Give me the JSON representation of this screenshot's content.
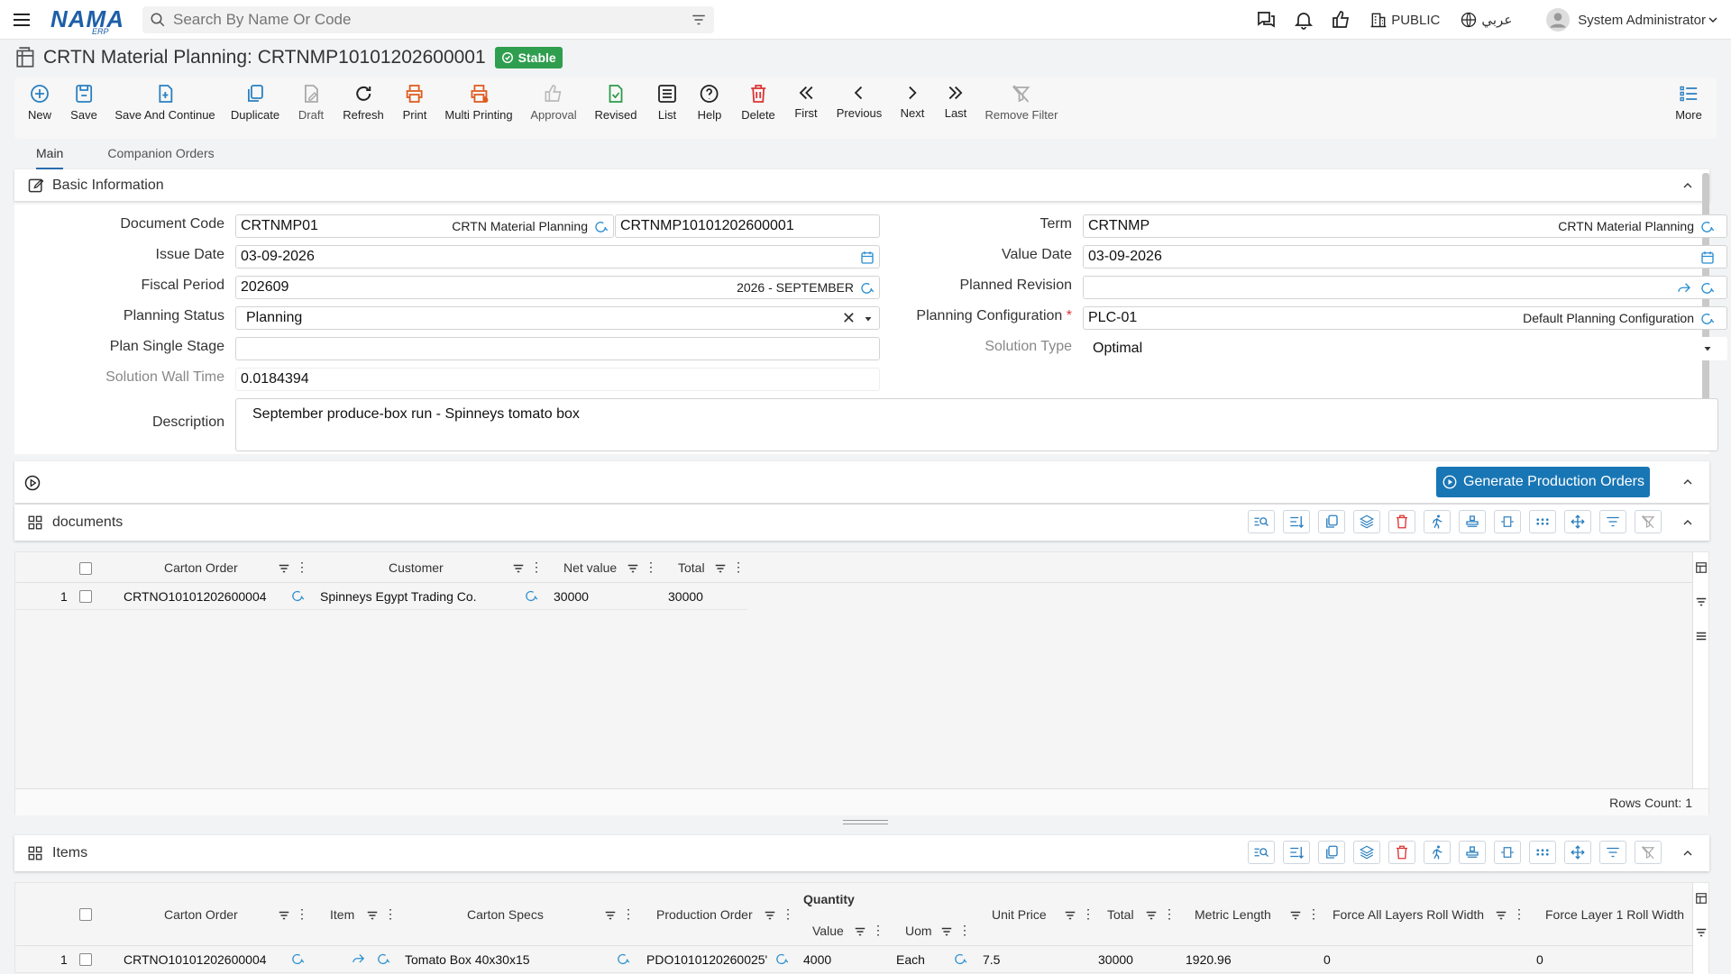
{
  "header": {
    "logo_text": "NAMA",
    "logo_sub": "ERP",
    "search_placeholder": "Search By Name Or Code",
    "visibility": "PUBLIC",
    "language": "عربي",
    "user": "System Administrator"
  },
  "title": {
    "text": "CRTN Material Planning: CRTNMP10101202600001",
    "status": "Stable"
  },
  "toolbar": [
    {
      "label": "New",
      "icon": "plus-circle-icon"
    },
    {
      "label": "Save",
      "icon": "save-icon"
    },
    {
      "label": "Save And Continue",
      "icon": "save-continue-icon"
    },
    {
      "label": "Duplicate",
      "icon": "duplicate-icon"
    },
    {
      "label": "Draft",
      "icon": "draft-icon"
    },
    {
      "label": "Refresh",
      "icon": "refresh-icon"
    },
    {
      "label": "Print",
      "icon": "print-icon"
    },
    {
      "label": "Multi Printing",
      "icon": "multi-print-icon"
    },
    {
      "label": "Approval",
      "icon": "thumbs-up-icon"
    },
    {
      "label": "Revised",
      "icon": "revised-icon"
    },
    {
      "label": "List",
      "icon": "list-icon"
    },
    {
      "label": "Help",
      "icon": "help-icon"
    },
    {
      "label": "Delete",
      "icon": "trash-icon"
    },
    {
      "label": "First",
      "icon": "double-chevron-left-icon"
    },
    {
      "label": "Previous",
      "icon": "chevron-left-icon"
    },
    {
      "label": "Next",
      "icon": "chevron-right-icon"
    },
    {
      "label": "Last",
      "icon": "double-chevron-right-icon"
    },
    {
      "label": "Remove Filter",
      "icon": "remove-filter-icon"
    },
    {
      "label": "More",
      "icon": "more-list-icon"
    }
  ],
  "tabs": [
    "Main",
    "Companion Orders"
  ],
  "basic": {
    "title": "Basic Information",
    "labels": {
      "document_code": "Document Code",
      "issue_date": "Issue Date",
      "fiscal_period": "Fiscal Period",
      "planning_status": "Planning Status",
      "plan_single_stage": "Plan Single Stage",
      "solution_wall_time": "Solution Wall Time",
      "description": "Description",
      "term": "Term",
      "value_date": "Value Date",
      "planned_revision": "Planned Revision",
      "planning_configuration": "Planning Configuration",
      "solution_type": "Solution Type"
    },
    "values": {
      "document_code": "CRTNMP01",
      "document_code_hint": "CRTN Material Planning",
      "code": "CRTNMP10101202600001",
      "issue_date": "03-09-2026",
      "fiscal_period": "202609",
      "fiscal_period_hint": "2026 - SEPTEMBER",
      "planning_status": "Planning",
      "plan_single_stage": "",
      "solution_wall_time": "0.0184394",
      "description": "September produce-box run - Spinneys tomato box",
      "term": "CRTNMP",
      "term_hint": "CRTN Material Planning",
      "value_date": "03-09-2026",
      "planned_revision": "",
      "planning_configuration": "PLC-01",
      "planning_configuration_hint": "Default Planning Configuration",
      "solution_type": "Optimal"
    }
  },
  "actions": {
    "generate_label": "Generate Production Orders"
  },
  "documents": {
    "title": "documents",
    "columns": [
      "Carton Order",
      "Customer",
      "Net value",
      "Total"
    ],
    "rows": [
      {
        "num": "1",
        "carton_order": "CRTNO10101202600004",
        "customer": "Spinneys Egypt Trading Co.",
        "net_value": "30000",
        "total": "30000"
      }
    ],
    "rows_count": "Rows Count: 1"
  },
  "items": {
    "title": "Items",
    "quantity_group": "Quantity",
    "columns": {
      "carton_order": "Carton Order",
      "item": "Item",
      "carton_specs": "Carton Specs",
      "production_order": "Production Order",
      "value": "Value",
      "uom": "Uom",
      "unit_price": "Unit Price",
      "total": "Total",
      "metric_length": "Metric Length",
      "force_all": "Force All Layers Roll Width",
      "force_layer1": "Force Layer 1 Roll Width"
    },
    "rows": [
      {
        "num": "1",
        "carton_order": "CRTNO10101202600004",
        "carton_specs": "Tomato Box 40x30x15",
        "production_order": "PDO1010120260025'",
        "value": "4000",
        "uom": "Each",
        "unit_price": "7.5",
        "total": "30000",
        "metric_length": "1920.96",
        "force_all": "0",
        "force_layer1": "0"
      }
    ]
  }
}
